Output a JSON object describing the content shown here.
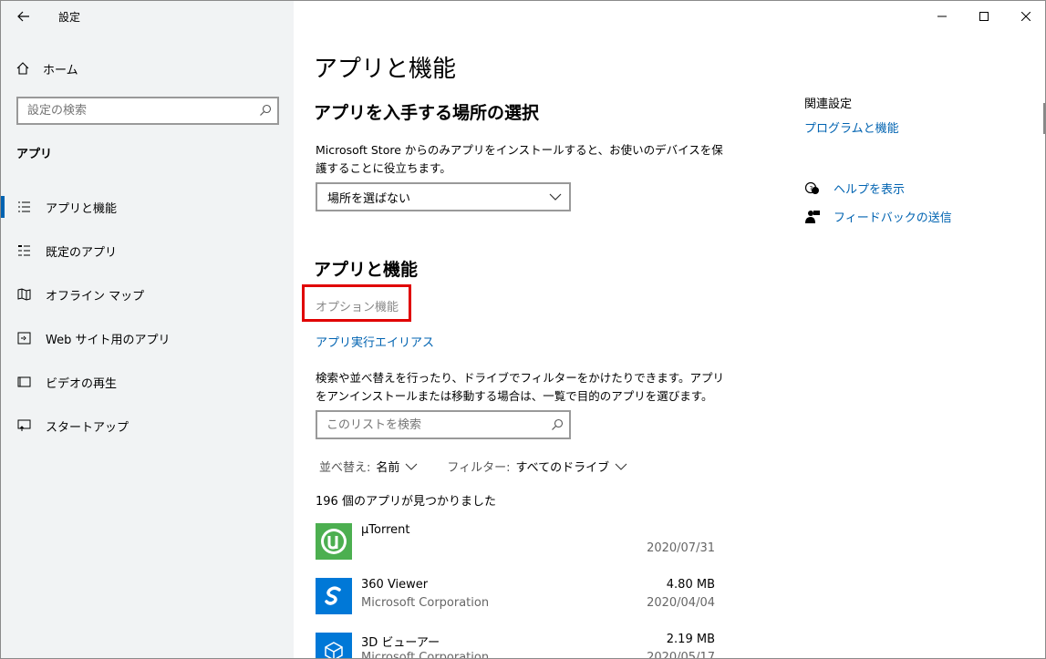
{
  "window": {
    "title": "設定"
  },
  "sidebar": {
    "home_label": "ホーム",
    "search_placeholder": "設定の検索",
    "section_label": "アプリ",
    "items": [
      {
        "label": "アプリと機能",
        "icon": "list-icon",
        "active": true
      },
      {
        "label": "既定のアプリ",
        "icon": "default-apps-icon"
      },
      {
        "label": "オフライン マップ",
        "icon": "map-icon"
      },
      {
        "label": "Web サイト用のアプリ",
        "icon": "web-app-icon"
      },
      {
        "label": "ビデオの再生",
        "icon": "video-icon"
      },
      {
        "label": "スタートアップ",
        "icon": "startup-icon"
      }
    ]
  },
  "main": {
    "page_title": "アプリと機能",
    "install_section": {
      "title": "アプリを入手する場所の選択",
      "description": "Microsoft Store からのみアプリをインストールすると、お使いのデバイスを保護することに役立ちます。",
      "dropdown_value": "場所を選ばない"
    },
    "apps_section": {
      "title": "アプリと機能",
      "optional_features_link": "オプション機能",
      "alias_link": "アプリ実行エイリアス",
      "description": "検索や並べ替えを行ったり、ドライブでフィルターをかけたりできます。アプリをアンインストールまたは移動する場合は、一覧で目的のアプリを選びます。",
      "search_placeholder": "このリストを検索",
      "sort_label": "並べ替え:",
      "sort_value": "名前",
      "filter_label": "フィルター:",
      "filter_value": "すべてのドライブ",
      "count_text": "196 個のアプリが見つかりました",
      "apps": [
        {
          "name": "µTorrent",
          "publisher": "",
          "size": "",
          "date": "2020/07/31",
          "icon_color": "#4caf50"
        },
        {
          "name": "360 Viewer",
          "publisher": "Microsoft Corporation",
          "size": "4.80 MB",
          "date": "2020/04/04",
          "icon_color": "#0078d7"
        },
        {
          "name": "3D ビューアー",
          "publisher": "Microsoft Corporation",
          "size": "2.19 MB",
          "date": "2020/05/17",
          "icon_color": "#0078d7"
        }
      ]
    }
  },
  "related": {
    "label": "関連設定",
    "programs_link": "プログラムと機能",
    "help_link": "ヘルプを表示",
    "feedback_link": "フィードバックの送信"
  },
  "colors": {
    "accent": "#0063b1",
    "highlight": "#e00000"
  }
}
